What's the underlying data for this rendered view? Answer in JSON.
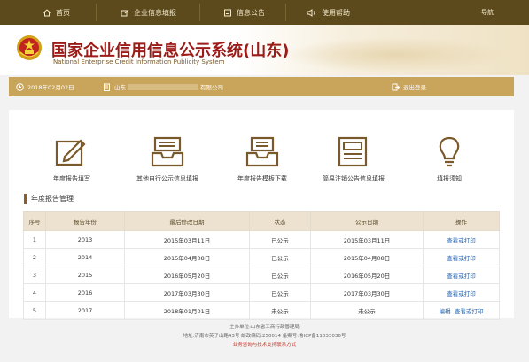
{
  "nav": {
    "items": [
      {
        "label": "首页",
        "icon": "home-icon"
      },
      {
        "label": "企业信息填报",
        "icon": "edit-icon"
      },
      {
        "label": "信息公告",
        "icon": "document-icon"
      },
      {
        "label": "使用帮助",
        "icon": "speaker-icon"
      }
    ],
    "right_link": "导航"
  },
  "banner": {
    "title_cn": "国家企业信用信息公示系统(山东)",
    "title_en": "National Enterprise Credit Information Publicity System"
  },
  "infobar": {
    "date": "2018年02月02日",
    "company_prefix": "山东",
    "company_suffix": "有限公司",
    "logout": "退出登录"
  },
  "quick_links": [
    {
      "label": "年度报告填写",
      "icon": "pencil-report-icon"
    },
    {
      "label": "其他自行公示信息填报",
      "icon": "inbox-icon"
    },
    {
      "label": "年度报告模板下载",
      "icon": "download-tray-icon"
    },
    {
      "label": "简易注销公告信息填报",
      "icon": "notice-icon"
    },
    {
      "label": "填报须知",
      "icon": "lightbulb-icon"
    }
  ],
  "section": {
    "title": "年度报告管理"
  },
  "table": {
    "headers": [
      "序号",
      "报告年份",
      "最后修改日期",
      "状态",
      "公示日期",
      "操作"
    ],
    "rows": [
      {
        "no": "1",
        "year": "2013",
        "modified": "2015年03月11日",
        "status": "已公示",
        "pub": "2015年03月11日",
        "action": "查看或打印",
        "edit": ""
      },
      {
        "no": "2",
        "year": "2014",
        "modified": "2015年04月08日",
        "status": "已公示",
        "pub": "2015年04月08日",
        "action": "查看或打印",
        "edit": ""
      },
      {
        "no": "3",
        "year": "2015",
        "modified": "2016年05月20日",
        "status": "已公示",
        "pub": "2016年05月20日",
        "action": "查看或打印",
        "edit": ""
      },
      {
        "no": "4",
        "year": "2016",
        "modified": "2017年03月30日",
        "status": "已公示",
        "pub": "2017年03月30日",
        "action": "查看或打印",
        "edit": ""
      },
      {
        "no": "5",
        "year": "2017",
        "modified": "2018年01月01日",
        "status": "未公示",
        "pub": "未公示",
        "action": "查看或打印",
        "edit": "编辑"
      }
    ]
  },
  "footer": {
    "line1": "主办单位:山东省工商行政管理局",
    "line2": "地址:济南市英子山路43号   邮政编码:250014   备案号:鲁ICP备11033036号",
    "line3": "业务咨询与技术支持联系方式"
  },
  "colors": {
    "nav_bg": "#5d4a1c",
    "accent": "#c9a45b",
    "title_red": "#9a1b17",
    "link_blue": "#1a5fb4"
  }
}
